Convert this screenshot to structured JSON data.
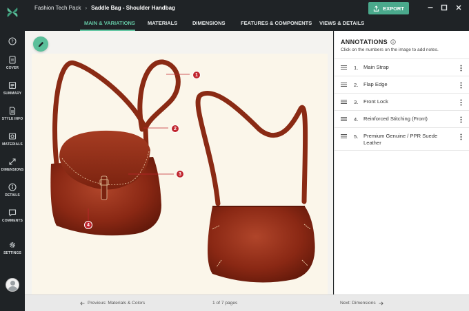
{
  "app": {
    "name": "Fashion Tech Pack"
  },
  "breadcrumb": {
    "root": "Fashion Tech Pack",
    "current": "Saddle Bag - Shoulder Handbag"
  },
  "toolbar": {
    "export_label": "EXPORT"
  },
  "tabs": [
    {
      "label": "MAIN & VARIATIONS",
      "active": true
    },
    {
      "label": "MATERIALS",
      "active": false
    },
    {
      "label": "DIMENSIONS",
      "active": false
    },
    {
      "label": "FEATURES & COMPONENTS",
      "active": false
    },
    {
      "label": "VIEWS & DETAILS",
      "active": false
    }
  ],
  "sidebar": {
    "items": [
      {
        "label": "",
        "icon": "help-icon"
      },
      {
        "label": "COVER",
        "icon": "file-icon"
      },
      {
        "label": "SUMMARY",
        "icon": "list-icon"
      },
      {
        "label": "STYLE INFO",
        "icon": "document-icon"
      },
      {
        "label": "MATERIALS",
        "icon": "materials-icon"
      },
      {
        "label": "DIMENSIONS",
        "icon": "expand-arrows-icon"
      },
      {
        "label": "DETAILS",
        "icon": "info-icon"
      },
      {
        "label": "COMMENTS",
        "icon": "chat-icon"
      },
      {
        "label": "SETTINGS",
        "icon": "gear-icon"
      }
    ]
  },
  "markers": [
    "1",
    "2",
    "3",
    "4"
  ],
  "annotations": {
    "title": "ANNOTATIONS",
    "hint": "Click on the numbers on the image to add notes.",
    "items": [
      {
        "num": "1.",
        "text": "Main Strap"
      },
      {
        "num": "2.",
        "text": "Flap Edge"
      },
      {
        "num": "3.",
        "text": "Front Lock"
      },
      {
        "num": "4.",
        "text": "Reinforced Stitching (Front)"
      },
      {
        "num": "5.",
        "text": "Premium Genuine / PPR Suede Leather"
      }
    ]
  },
  "footer": {
    "prev": "Previous: Materials & Colors",
    "page": "1 of 7 pages",
    "next": "Next: Dimensions"
  },
  "colors": {
    "accent": "#64c7a4",
    "export": "#4aa98c",
    "marker": "#c0242d",
    "leather": "#8e2a14"
  }
}
